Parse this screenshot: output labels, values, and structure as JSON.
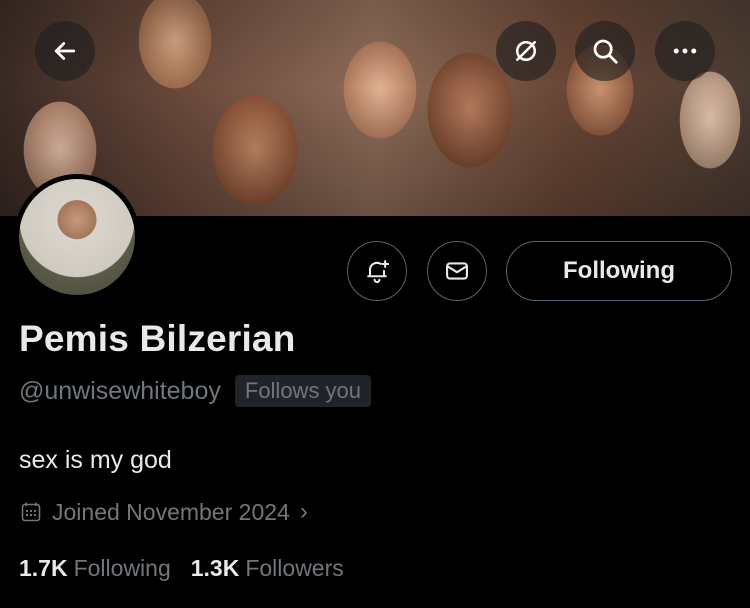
{
  "header": {
    "back_icon": "arrow-left-icon",
    "grok_icon": "grok-icon",
    "search_icon": "search-icon",
    "more_icon": "more-horizontal-icon"
  },
  "profile": {
    "display_name": "Pemis Bilzerian",
    "handle": "@unwisewhiteboy",
    "follows_you": "Follows you",
    "bio": "sex is my god",
    "joined": "Joined November 2024"
  },
  "actions": {
    "notify_icon": "bell-plus-icon",
    "message_icon": "envelope-icon",
    "following_label": "Following"
  },
  "stats": {
    "following_count": "1.7K",
    "following_label": "Following",
    "followers_count": "1.3K",
    "followers_label": "Followers"
  },
  "colors": {
    "background": "#000000",
    "text_primary": "#e7e9ea",
    "text_secondary": "#71767b",
    "border": "#536471",
    "badge_bg": "#202327"
  }
}
